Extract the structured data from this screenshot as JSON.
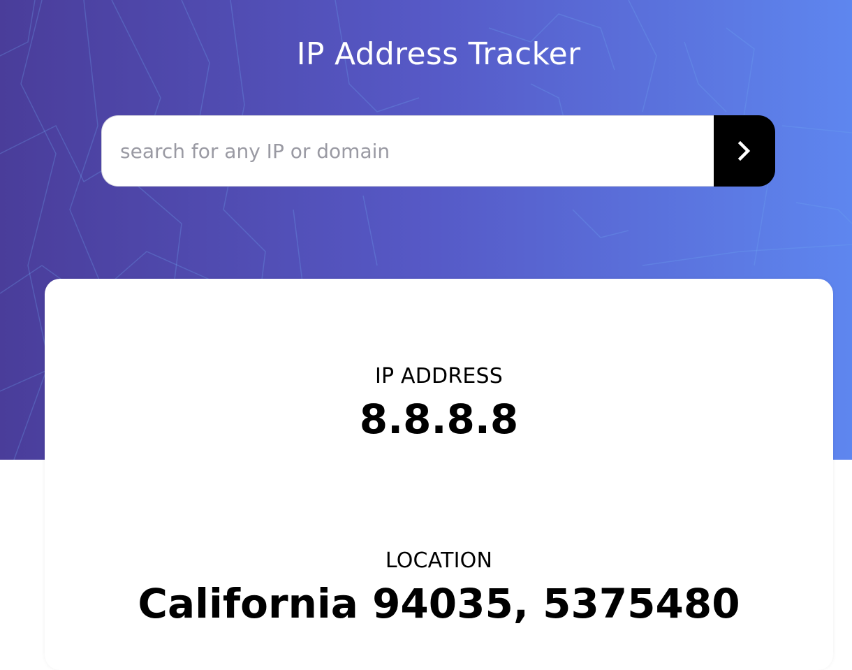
{
  "app": {
    "title": "IP Address Tracker"
  },
  "search": {
    "placeholder": "search for any IP or domain",
    "value": "",
    "button_icon": "chevron-right-icon"
  },
  "info": {
    "ip_label": "IP ADDRESS",
    "ip_value": "8.8.8.8",
    "location_label": "LOCATION",
    "location_value": "California 94035, 5375480"
  },
  "colors": {
    "hero_gradient_start": "#4a3d9a",
    "hero_gradient_end": "#5e86ef",
    "button": "#000000",
    "card": "#ffffff"
  }
}
